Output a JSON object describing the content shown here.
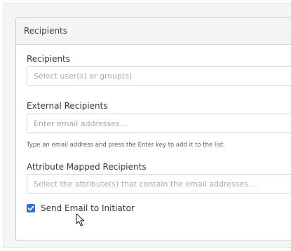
{
  "panel": {
    "title": "Recipients"
  },
  "recipients": {
    "label": "Recipients",
    "placeholder": "Select user(s) or group(s)"
  },
  "external": {
    "label": "External Recipients",
    "placeholder": "Enter email addresses...",
    "hint": "Type an email address and press the Enter key to add it to the list."
  },
  "attribute": {
    "label": "Attribute Mapped Recipients",
    "placeholder": "Select the attribute(s) that contain the email addresses..."
  },
  "initiator": {
    "label": "Send Email to Initiator",
    "checked": true
  },
  "icons": {
    "checkbox": "checkmark-icon",
    "cursor": "mouse-pointer-icon"
  },
  "colors": {
    "accent": "#2f6fd6"
  }
}
